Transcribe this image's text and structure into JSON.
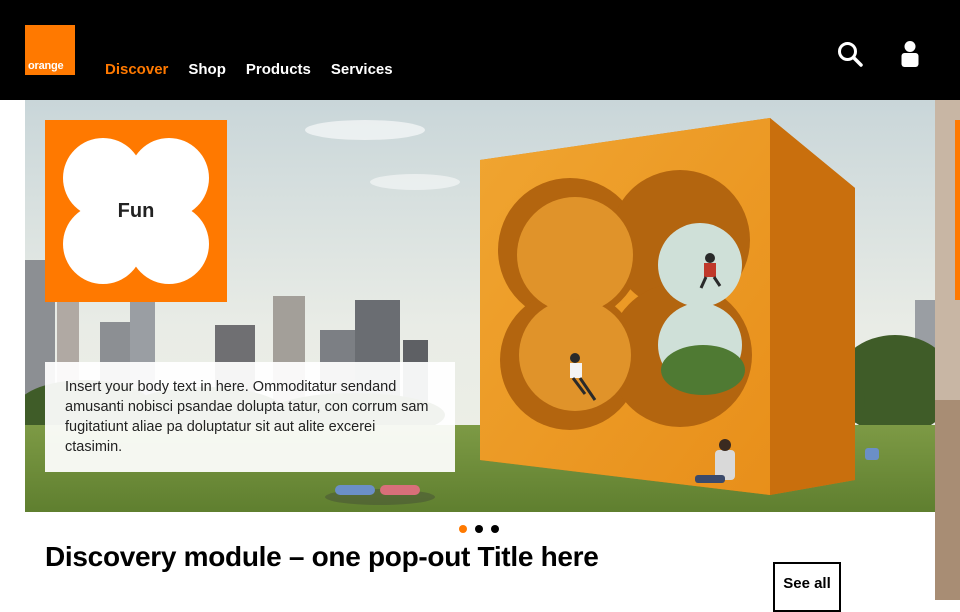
{
  "brand": {
    "logo_text": "orange",
    "accent": "#ff7900"
  },
  "header": {
    "nav": [
      {
        "label": "Discover",
        "active": true
      },
      {
        "label": "Shop"
      },
      {
        "label": "Products"
      },
      {
        "label": "Services"
      }
    ],
    "icons": [
      "search-icon",
      "user-icon"
    ]
  },
  "hero": {
    "badge_label": "Fun",
    "body_text": "Insert your body text in here. Ommoditatur sendand amusanti nobisci psandae dolupta tatur, con corrum sam fugitatiunt aliae pa doluptatur sit aut alite excerei ctasimin.",
    "dots": 3,
    "active_dot": 1
  },
  "module": {
    "title": "Discovery module – one pop-out Title here",
    "see_all_label": "See all"
  }
}
